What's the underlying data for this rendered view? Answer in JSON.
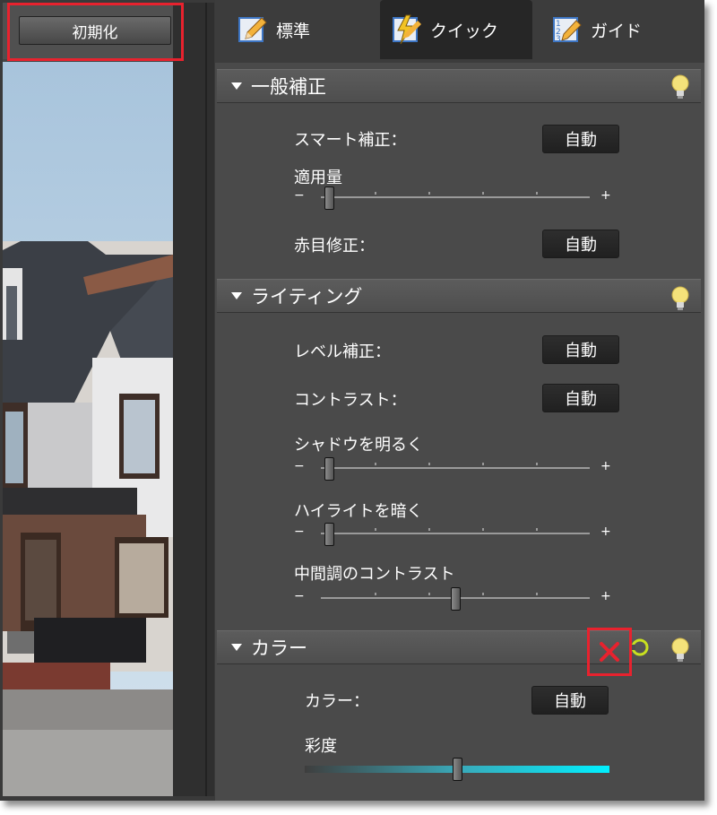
{
  "toolbar": {
    "reset_label": "初期化"
  },
  "tabs": [
    {
      "label": "標準",
      "icon": "pencil-icon"
    },
    {
      "label": "クイック",
      "icon": "lightning-icon"
    },
    {
      "label": "ガイド",
      "icon": "abc-icon"
    }
  ],
  "active_tab": "クイック",
  "sections": {
    "general": {
      "title": "一般補正",
      "smart_fix_label": "スマート補正：",
      "smart_fix_button": "自動",
      "amount_label": "適用量",
      "red_eye_label": "赤目修正：",
      "red_eye_button": "自動"
    },
    "lighting": {
      "title": "ライティング",
      "levels_label": "レベル補正：",
      "levels_button": "自動",
      "contrast_label": "コントラスト：",
      "contrast_button": "自動",
      "lighten_shadows_label": "シャドウを明るく",
      "darken_highlights_label": "ハイライトを暗く",
      "midtone_contrast_label": "中間調のコントラスト"
    },
    "color": {
      "title": "カラー",
      "color_label": "カラー：",
      "color_button": "自動",
      "saturation_label": "彩度"
    }
  },
  "slider_values": {
    "amount": 0.03,
    "lighten_shadows": 0.03,
    "darken_highlights": 0.03,
    "midtone_contrast": 0.5,
    "saturation": 0.5
  },
  "slider_symbols": {
    "minus": "−",
    "plus": "+"
  },
  "colors": {
    "panel_bg": "#4a4a4a",
    "highlight_red": "#e8222e",
    "cancel_x": "#e8222e",
    "commit_green": "#c8e020",
    "bulb_yellow": "#f4e27a",
    "saturation_cyan": "#00f0ff"
  }
}
